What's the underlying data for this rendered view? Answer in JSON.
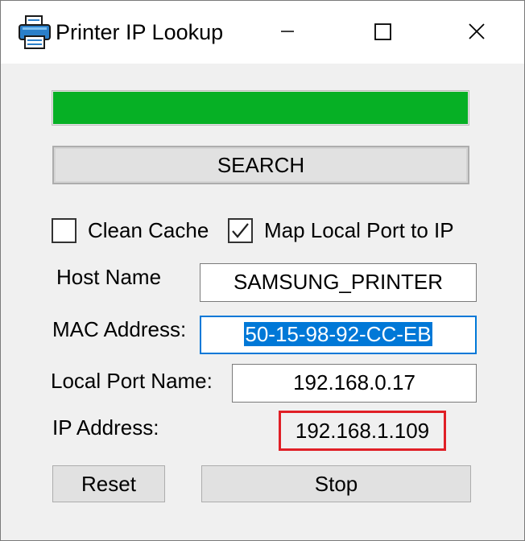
{
  "window": {
    "title": "Printer IP Lookup",
    "app_icon": "printer-icon",
    "controls": {
      "minimize": "minimize-icon",
      "maximize": "maximize-icon",
      "close": "close-icon"
    }
  },
  "progress": {
    "fraction": 1.0,
    "color": "#06b025"
  },
  "search_button": {
    "label": "SEARCH"
  },
  "options": {
    "clean_cache": {
      "label": "Clean Cache",
      "checked": false
    },
    "map_local_port": {
      "label": "Map Local Port to IP",
      "checked": true
    }
  },
  "fields": {
    "host_name": {
      "label": "Host Name",
      "value": "SAMSUNG_PRINTER"
    },
    "mac_address": {
      "label": "MAC Address:",
      "value": "50-15-98-92-CC-EB"
    },
    "local_port_name": {
      "label": "Local Port Name:",
      "value": "192.168.0.17"
    },
    "ip_address": {
      "label": "IP Address:",
      "value": "192.168.1.109",
      "highlight_color": "#e01f26"
    }
  },
  "buttons": {
    "reset": "Reset",
    "stop": "Stop"
  },
  "colors": {
    "selection": "#0078d7",
    "window_bg": "#f0f0f0"
  }
}
